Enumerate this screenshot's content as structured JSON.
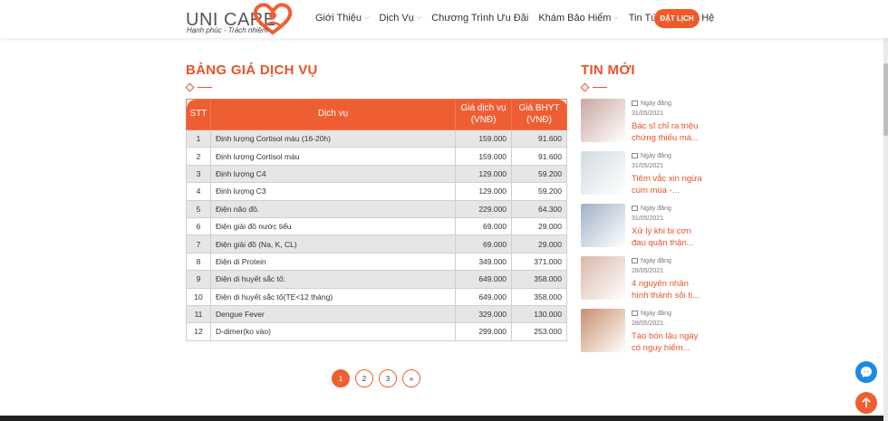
{
  "brand": {
    "name_uni": "UNI",
    "name_care": "CARE",
    "tagline": "Hạnh phúc - Trách nhiệm"
  },
  "nav": {
    "items": [
      {
        "label": "Giới Thiệu",
        "dropdown": true
      },
      {
        "label": "Dịch Vụ",
        "dropdown": true
      },
      {
        "label": "Chương Trình Ưu Đãi",
        "dropdown": false
      },
      {
        "label": "Khám Bảo Hiểm",
        "dropdown": true
      },
      {
        "label": "Tin Tức",
        "dropdown": true
      },
      {
        "label": "Liên Hệ",
        "dropdown": false
      }
    ],
    "cta": "ĐẶT LỊCH"
  },
  "price_section": {
    "title": "BẢNG GIÁ DỊCH VỤ",
    "headers": {
      "stt": "STT",
      "service": "Dịch vụ",
      "price": "Giá dịch vụ (VNĐ)",
      "bhyt": "Giá BHYT (VNĐ)"
    },
    "rows": [
      {
        "stt": "1",
        "service": "Định lượng Cortisol máu (16-20h)",
        "price": "159.000",
        "bhyt": "91.600"
      },
      {
        "stt": "2",
        "service": "Định lượng Cortisol máu",
        "price": "159.000",
        "bhyt": "91.600"
      },
      {
        "stt": "3",
        "service": "Định lượng C4",
        "price": "129.000",
        "bhyt": "59.200"
      },
      {
        "stt": "4",
        "service": "Định lượng C3",
        "price": "129.000",
        "bhyt": "59.200"
      },
      {
        "stt": "5",
        "service": "Điện não đồ.",
        "price": "229.000",
        "bhyt": "64.300"
      },
      {
        "stt": "6",
        "service": "Điện giải đồ nước tiểu",
        "price": "69.000",
        "bhyt": "29.000"
      },
      {
        "stt": "7",
        "service": "Điện giải đồ (Na, K, CL)",
        "price": "69.000",
        "bhyt": "29.000"
      },
      {
        "stt": "8",
        "service": "Điện di Protein",
        "price": "349.000",
        "bhyt": "371.000"
      },
      {
        "stt": "9",
        "service": "Điện di huyết sắc tố:",
        "price": "649.000",
        "bhyt": "358.000"
      },
      {
        "stt": "10",
        "service": "Điện di huyết sắc tố(TE<12 tháng)",
        "price": "649.000",
        "bhyt": "358.000"
      },
      {
        "stt": "11",
        "service": "Dengue Fever",
        "price": "329.000",
        "bhyt": "130.000"
      },
      {
        "stt": "12",
        "service": "D-dimer(ko vào)",
        "price": "299.000",
        "bhyt": "253.000"
      }
    ],
    "pagination": {
      "pages": [
        "1",
        "2",
        "3"
      ],
      "current": "1",
      "next_label": "»"
    }
  },
  "news_section": {
    "title": "TIN MỚI",
    "items": [
      {
        "meta_label": "Ngày đăng",
        "date": "31/05/2021",
        "title": "Bác sĩ chỉ ra triệu chứng thiếu má...",
        "thumb_color": "#c9a7a0",
        "icon": "kidney-thumb-icon"
      },
      {
        "meta_label": "Ngày đăng",
        "date": "31/05/2021",
        "title": "Tiêm vắc xin ngừa cúm mùa -...",
        "thumb_color": "#d3dbe0",
        "icon": "vaccine-thumb-icon"
      },
      {
        "meta_label": "Ngày đăng",
        "date": "31/05/2021",
        "title": "Xử lý khi bị cơn đau quặn thận...",
        "thumb_color": "#9fb3c8",
        "icon": "back-pain-thumb-icon"
      },
      {
        "meta_label": "Ngày đăng",
        "date": "28/05/2021",
        "title": "4 nguyên nhân hình thành sỏi ti...",
        "thumb_color": "#d9b8a8",
        "icon": "pills-thumb-icon"
      },
      {
        "meta_label": "Ngày đăng",
        "date": "28/05/2021",
        "title": "Táo bón lâu ngày có nguy hiểm...",
        "thumb_color": "#c98f6e",
        "icon": "colon-thumb-icon"
      }
    ]
  },
  "colors": {
    "accent": "#ef5e33",
    "messenger": "#1e88e5"
  }
}
